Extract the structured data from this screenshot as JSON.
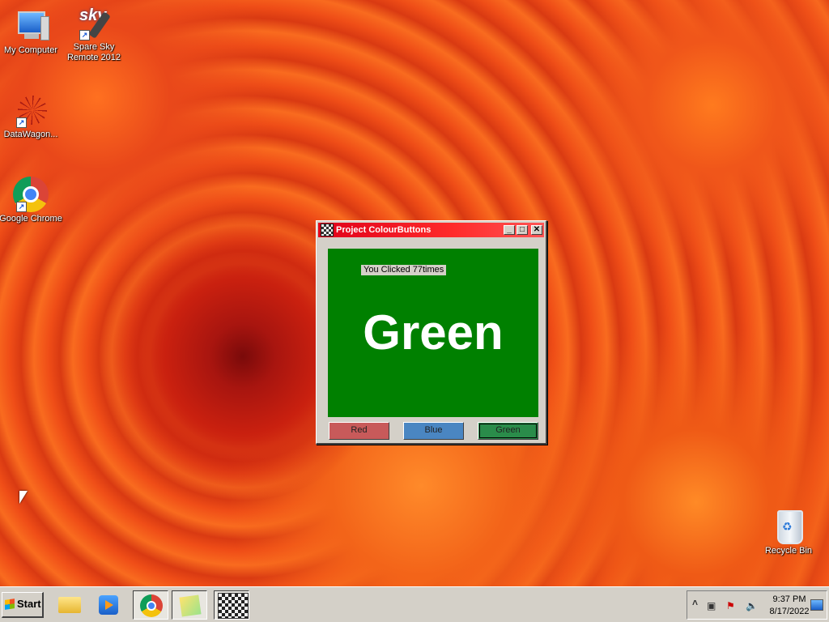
{
  "desktop": {
    "icons": [
      {
        "label": "My Computer",
        "icon": "computer-icon"
      },
      {
        "label": "Spare Sky Remote 2012",
        "label_line1": "Spare Sky",
        "label_line2": "Remote 2012",
        "icon": "sky-remote-icon",
        "logo_text": "sky"
      },
      {
        "label": "DataWagon...",
        "icon": "datawagon-icon"
      },
      {
        "label": "Google Chrome",
        "icon": "chrome-icon"
      },
      {
        "label": "Recycle Bin",
        "icon": "recycle-bin-icon"
      }
    ]
  },
  "window": {
    "title": "Project ColourButtons",
    "controls": {
      "minimize": "_",
      "maximize": "□",
      "close": "✕"
    },
    "click_label": "You Clicked 77times",
    "current_colour_text": "Green",
    "panel_color": "#008000",
    "buttons": [
      {
        "label": "Red",
        "color": "#c85a5a"
      },
      {
        "label": "Blue",
        "color": "#4a86c2"
      },
      {
        "label": "Green",
        "color": "#2a8c4a"
      }
    ]
  },
  "taskbar": {
    "start_label": "Start",
    "items": [
      "file-explorer-icon",
      "media-player-icon",
      "chrome-icon",
      "sticky-notes-icon",
      "colourbuttons-app-icon"
    ],
    "tray": {
      "expand": "˄",
      "time": "9:37 PM",
      "date": "8/17/2022"
    }
  }
}
